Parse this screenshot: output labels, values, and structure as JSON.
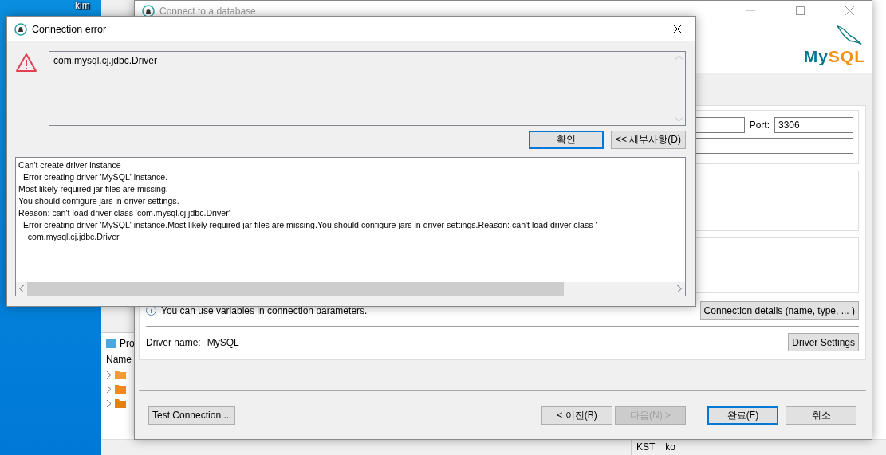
{
  "desktop": {
    "user_label": "kim"
  },
  "background_window": {
    "panel_tab": "Pro",
    "column_header": "Name",
    "tree_items": [
      {
        "kind": "favorites",
        "expanded": false
      },
      {
        "kind": "connections",
        "expanded": false
      },
      {
        "kind": "scripts",
        "expanded": false
      }
    ],
    "status_bar": [
      "KST",
      "ko"
    ]
  },
  "connect_window": {
    "title": "Connect to a database",
    "logo": [
      "My",
      "SQL"
    ],
    "port_label": "Port:",
    "port_value": "3306",
    "info_text": "You can use variables in connection parameters.",
    "connection_details_button": "Connection details (name, type, ... )",
    "driver_label": "Driver name:",
    "driver_value": "MySQL",
    "driver_settings_button": "Driver Settings",
    "test_button": "Test Connection ...",
    "buttons": [
      {
        "label": "< 이전(B)",
        "disabled": false,
        "focused": false
      },
      {
        "label": "다음(N) >",
        "disabled": true,
        "focused": false
      },
      {
        "label": "완료(F)",
        "disabled": false,
        "focused": true
      },
      {
        "label": "취소",
        "disabled": false,
        "focused": false
      }
    ]
  },
  "error_dialog": {
    "title": "Connection error",
    "message": "com.mysql.cj.jdbc.Driver",
    "buttons": [
      {
        "label": "확인",
        "focused": true
      },
      {
        "label": "<< 세부사항(D)",
        "focused": false
      }
    ],
    "details": [
      "Can't create driver instance",
      "  Error creating driver 'MySQL' instance.",
      "Most likely required jar files are missing.",
      "You should configure jars in driver settings.",
      "Reason: can't load driver class 'com.mysql.cj.jdbc.Driver'",
      "  Error creating driver 'MySQL' instance.Most likely required jar files are missing.You should configure jars in driver settings.Reason: can't load driver class '",
      "    com.mysql.cj.jdbc.Driver"
    ]
  }
}
